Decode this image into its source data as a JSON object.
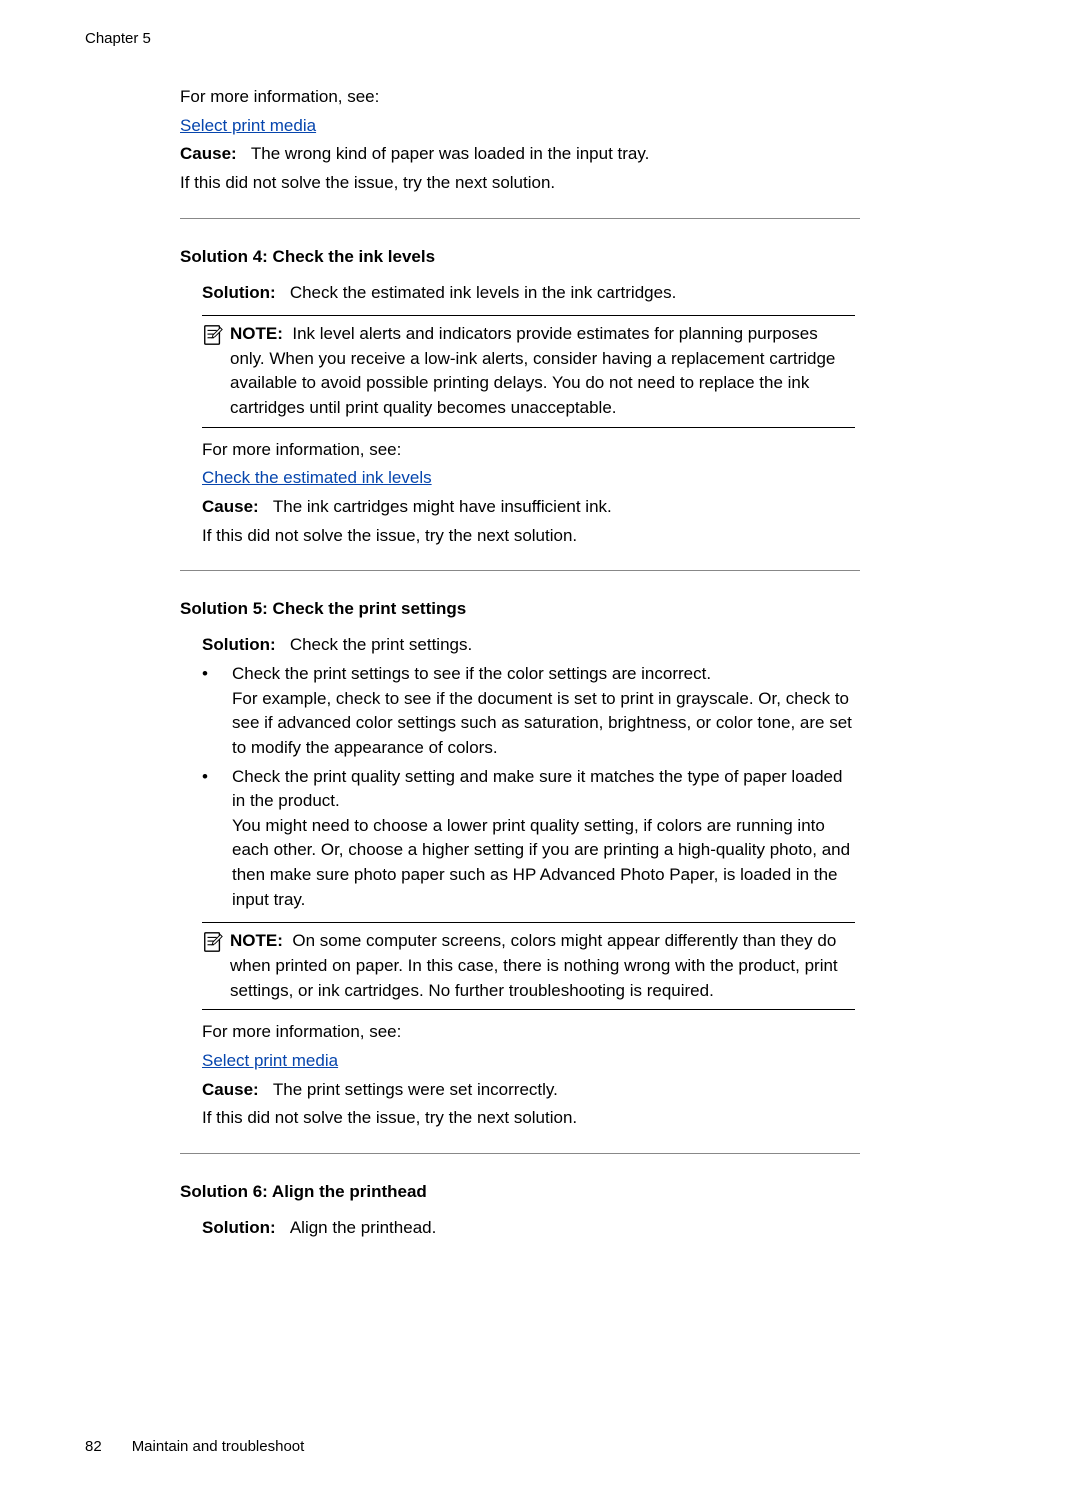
{
  "header": {
    "chapter": "Chapter 5"
  },
  "intro": {
    "more_info": "For more information, see:",
    "link": "Select print media",
    "cause_label": "Cause:",
    "cause_text": "The wrong kind of paper was loaded in the input tray.",
    "unsolved": "If this did not solve the issue, try the next solution."
  },
  "sol4": {
    "heading": "Solution 4: Check the ink levels",
    "solution_label": "Solution:",
    "solution_text": "Check the estimated ink levels in the ink cartridges.",
    "note_label": "NOTE:",
    "note_text": "Ink level alerts and indicators provide estimates for planning purposes only. When you receive a low-ink alerts, consider having a replacement cartridge available to avoid possible printing delays. You do not need to replace the ink cartridges until print quality becomes unacceptable.",
    "more_info": "For more information, see:",
    "link": "Check the estimated ink levels",
    "cause_label": "Cause:",
    "cause_text": "The ink cartridges might have insufficient ink.",
    "unsolved": "If this did not solve the issue, try the next solution."
  },
  "sol5": {
    "heading": "Solution 5: Check the print settings",
    "solution_label": "Solution:",
    "solution_text": "Check the print settings.",
    "b1_a": "Check the print settings to see if the color settings are incorrect.",
    "b1_b": "For example, check to see if the document is set to print in grayscale. Or, check to see if advanced color settings such as saturation, brightness, or color tone, are set to modify the appearance of colors.",
    "b2_a": "Check the print quality setting and make sure it matches the type of paper loaded in the product.",
    "b2_b": "You might need to choose a lower print quality setting, if colors are running into each other. Or, choose a higher setting if you are printing a high-quality photo, and then make sure photo paper such as HP Advanced Photo Paper, is loaded in the input tray.",
    "note_label": "NOTE:",
    "note_text": "On some computer screens, colors might appear differently than they do when printed on paper. In this case, there is nothing wrong with the product, print settings, or ink cartridges. No further troubleshooting is required.",
    "more_info": "For more information, see:",
    "link": "Select print media",
    "cause_label": "Cause:",
    "cause_text": "The print settings were set incorrectly.",
    "unsolved": "If this did not solve the issue, try the next solution."
  },
  "sol6": {
    "heading": "Solution 6: Align the printhead",
    "solution_label": "Solution:",
    "solution_text": "Align the printhead."
  },
  "footer": {
    "page": "82",
    "title": "Maintain and troubleshoot"
  },
  "icons": {
    "note": "note-icon"
  }
}
